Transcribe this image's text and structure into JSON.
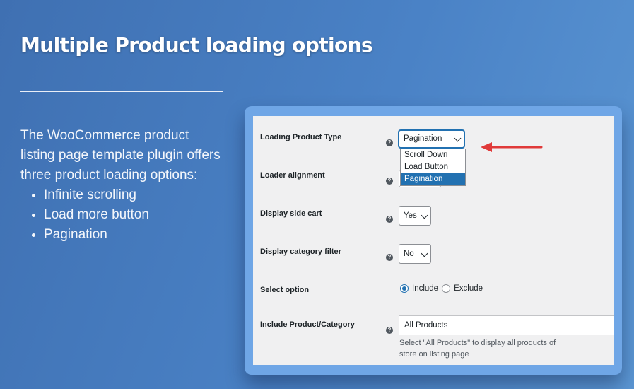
{
  "heading": "Multiple Product loading options",
  "description": {
    "intro": "The WooCommerce product listing page template plugin offers three product loading options:",
    "bullets": [
      "Infinite scrolling",
      "Load more button",
      "Pagination"
    ]
  },
  "settings": {
    "loading_product_type": {
      "label": "Loading Product Type",
      "value": "Pagination",
      "options": [
        "Scroll Down",
        "Load Button",
        "Pagination"
      ]
    },
    "loader_alignment": {
      "label": "Loader alignment"
    },
    "display_side_cart": {
      "label": "Display side cart",
      "value": "Yes"
    },
    "display_category_filter": {
      "label": "Display category filter",
      "value": "No"
    },
    "select_option": {
      "label": "Select option",
      "include": "Include",
      "exclude": "Exclude",
      "selected": "Include"
    },
    "include_product_category": {
      "label": "Include Product/Category",
      "value": "All Products",
      "hint": "Select \"All Products\" to display all products of store on listing page"
    },
    "help_icon": "?"
  },
  "colors": {
    "accent": "#2271b1",
    "arrow": "#e03a3a",
    "panel_frame": "#6fa6e6"
  }
}
